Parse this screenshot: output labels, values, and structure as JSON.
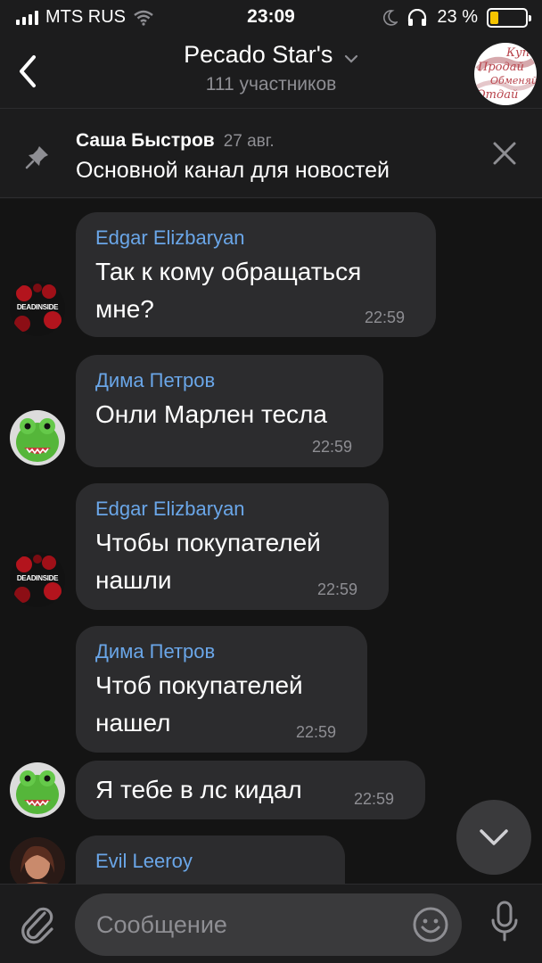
{
  "status_bar": {
    "carrier": "MTS RUS",
    "time": "23:09",
    "battery_percent": "23 %",
    "battery_level": 0.23
  },
  "header": {
    "title": "Pecado Star's",
    "subtitle": "111 участников",
    "avatar_words": [
      "Купи",
      "Продай",
      "Обменяй",
      "Отдай"
    ]
  },
  "pinned": {
    "author": "Саша Быстров",
    "date": "27 авг.",
    "text": "Основной канал для новостей"
  },
  "messages": [
    {
      "sender": "Edgar Elizbaryan",
      "lines": [
        "Так к кому обращаться",
        "мне?"
      ],
      "time": "22:59",
      "avatar": "DEADINSIDE"
    },
    {
      "sender": "Дима Петров",
      "lines": [
        "Онли Марлен тесла"
      ],
      "time": "22:59",
      "avatar": "frog"
    },
    {
      "sender": "Edgar Elizbaryan",
      "lines": [
        "Чтобы покупателей",
        "нашли"
      ],
      "time": "22:59",
      "avatar": "DEADINSIDE"
    },
    {
      "sender": "Дима Петров",
      "lines": [
        "Чтоб покупателей",
        "нашел"
      ],
      "time": "22:59",
      "avatar": null
    },
    {
      "sender": "",
      "lines": [
        "Я тебе в лс кидал"
      ],
      "time": "22:59",
      "avatar": "frog"
    },
    {
      "sender": "Evil Leeroy",
      "lines": [],
      "time": "",
      "avatar": "photo"
    }
  ],
  "input": {
    "placeholder": "Сообщение"
  },
  "colors": {
    "background": "#141414",
    "bubble": "#2c2c2e",
    "sender_name": "#6aa6e8",
    "battery": "#f5c400"
  }
}
